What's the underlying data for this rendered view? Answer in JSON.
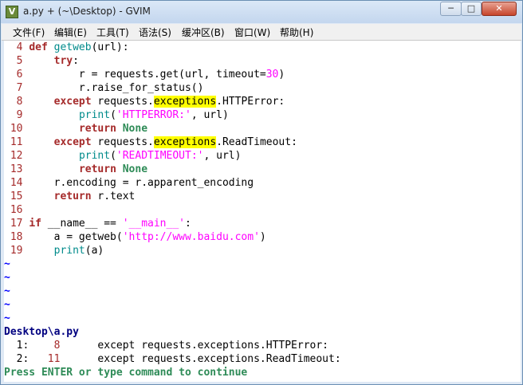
{
  "window": {
    "title": "a.py + (~\\Desktop) - GVIM",
    "app_icon": "gvim-icon",
    "min_glyph": "─",
    "max_glyph": "□",
    "close_glyph": "✕"
  },
  "menu": [
    "文件(F)",
    "编辑(E)",
    "工具(T)",
    "语法(S)",
    "缓冲区(B)",
    "窗口(W)",
    "帮助(H)"
  ],
  "code_lines": [
    {
      "num": "4",
      "segs": [
        [
          "kw",
          "def "
        ],
        [
          "fn",
          "getweb"
        ],
        [
          "",
          "(url):"
        ]
      ]
    },
    {
      "num": "5",
      "segs": [
        [
          "",
          "    "
        ],
        [
          "kw",
          "try"
        ],
        [
          "",
          ":"
        ]
      ]
    },
    {
      "num": "6",
      "segs": [
        [
          "",
          "        r = requests.get(url, timeout="
        ],
        [
          "num",
          "30"
        ],
        [
          "",
          ")"
        ]
      ]
    },
    {
      "num": "7",
      "segs": [
        [
          "",
          "        r.raise_for_status()"
        ]
      ]
    },
    {
      "num": "8",
      "segs": [
        [
          "",
          "    "
        ],
        [
          "kw",
          "except"
        ],
        [
          "",
          " requests."
        ],
        [
          "hl",
          "exceptions"
        ],
        [
          "",
          ".HTTPError:"
        ]
      ]
    },
    {
      "num": "9",
      "segs": [
        [
          "",
          "        "
        ],
        [
          "fn",
          "print"
        ],
        [
          "",
          "("
        ],
        [
          "str",
          "'HTTPERROR:'"
        ],
        [
          "",
          ", url)"
        ]
      ]
    },
    {
      "num": "10",
      "segs": [
        [
          "",
          "        "
        ],
        [
          "kw",
          "return"
        ],
        [
          "",
          " "
        ],
        [
          "kw2",
          "None"
        ]
      ]
    },
    {
      "num": "11",
      "segs": [
        [
          "",
          "    "
        ],
        [
          "kw",
          "except"
        ],
        [
          "",
          " requests."
        ],
        [
          "hl",
          "exceptions"
        ],
        [
          "",
          ".ReadTimeout:"
        ]
      ]
    },
    {
      "num": "12",
      "segs": [
        [
          "",
          "        "
        ],
        [
          "fn",
          "print"
        ],
        [
          "",
          "("
        ],
        [
          "str",
          "'READTIMEOUT:'"
        ],
        [
          "",
          ", url)"
        ]
      ]
    },
    {
      "num": "13",
      "segs": [
        [
          "",
          "        "
        ],
        [
          "kw",
          "return"
        ],
        [
          "",
          " "
        ],
        [
          "kw2",
          "None"
        ]
      ]
    },
    {
      "num": "14",
      "segs": [
        [
          "",
          "    r.encoding = r.apparent_encoding"
        ]
      ]
    },
    {
      "num": "15",
      "segs": [
        [
          "",
          "    "
        ],
        [
          "kw",
          "return"
        ],
        [
          "",
          " r.text"
        ]
      ]
    },
    {
      "num": "16",
      "segs": []
    },
    {
      "num": "17",
      "segs": [
        [
          "kw",
          "if"
        ],
        [
          "",
          " __name__ == "
        ],
        [
          "str",
          "'__main__'"
        ],
        [
          "",
          ":"
        ]
      ]
    },
    {
      "num": "18",
      "segs": [
        [
          "",
          "    a = getweb("
        ],
        [
          "str",
          "'http://www.baidu.com'"
        ],
        [
          "",
          ")"
        ]
      ]
    },
    {
      "num": "19",
      "segs": [
        [
          "",
          "    "
        ],
        [
          "fn",
          "print"
        ],
        [
          "",
          "(a)"
        ]
      ]
    }
  ],
  "tilde_lines": [
    "~",
    "~",
    "~",
    "~",
    "~"
  ],
  "search_path": "Desktop\\a.py",
  "quickfix": [
    {
      "index": "1:",
      "line": "8",
      "text": "except requests.exceptions.HTTPError:"
    },
    {
      "index": "2:",
      "line": "11",
      "text": "except requests.exceptions.ReadTimeout:"
    }
  ],
  "prompt": "Press ENTER or type command to continue"
}
